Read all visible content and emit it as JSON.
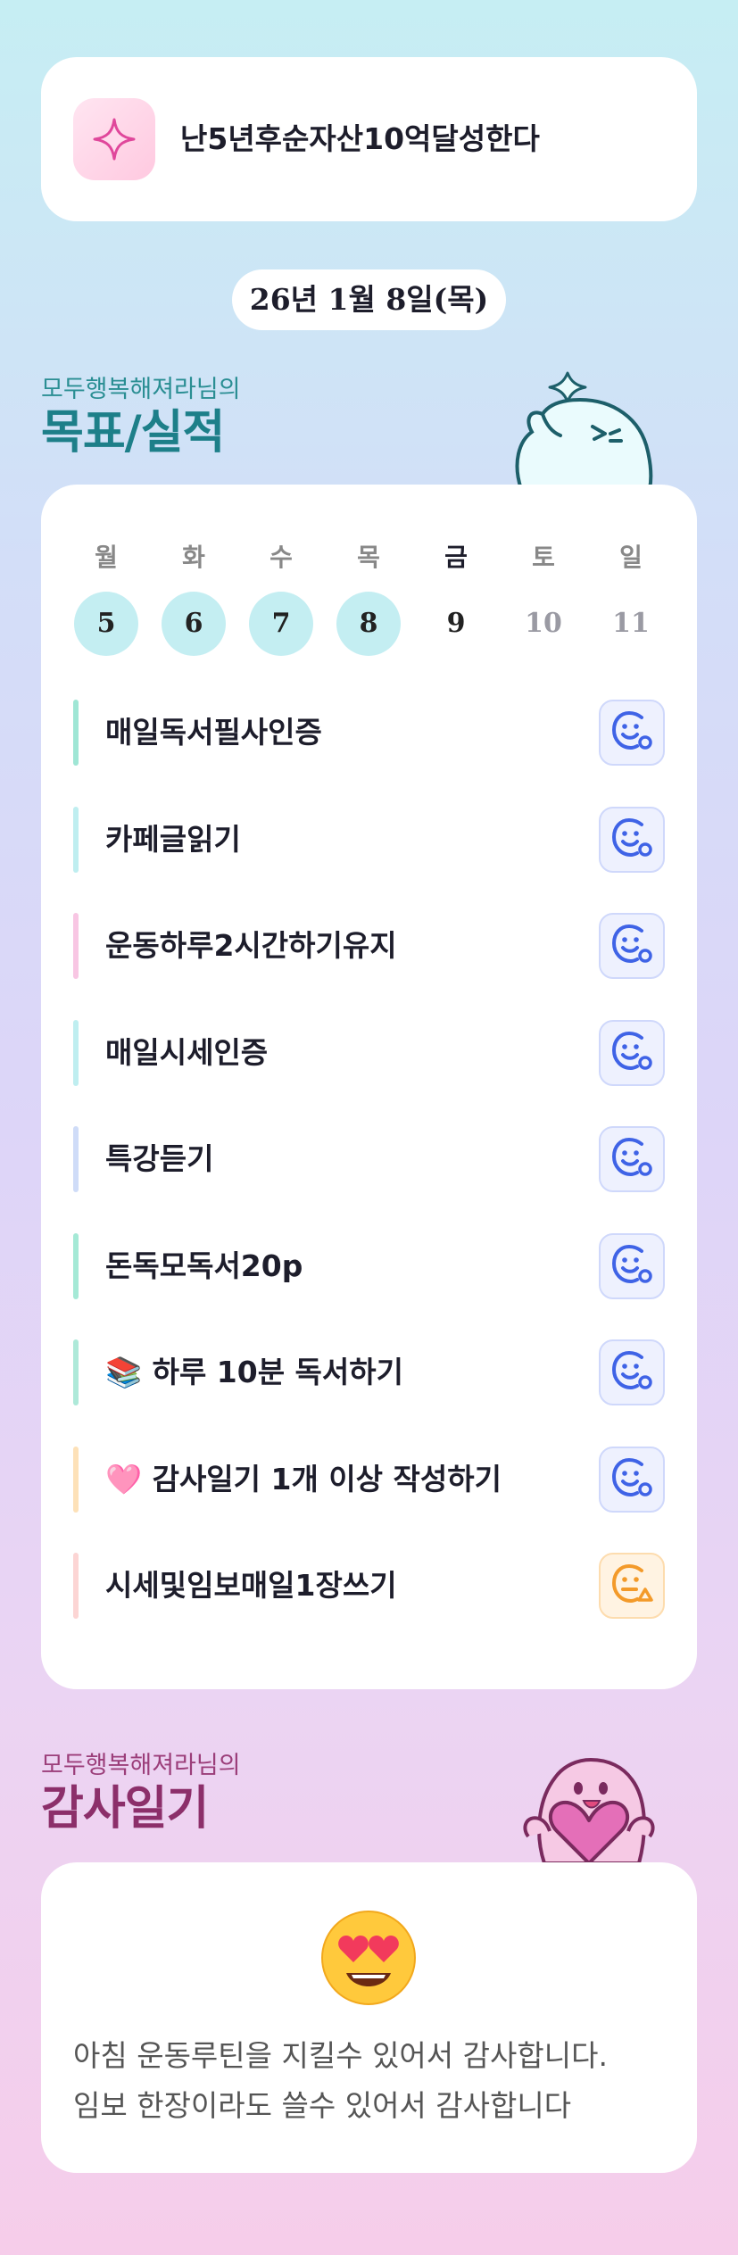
{
  "goal": {
    "text": "난5년후순자산10억달성한다",
    "icon": "sparkle-icon"
  },
  "date_label": "26년 1월 8일(목)",
  "goals_section": {
    "subtitle": "모두행복해져라님의",
    "title": "목표/실적"
  },
  "calendar": {
    "weekdays": [
      "월",
      "화",
      "수",
      "목",
      "금",
      "토",
      "일"
    ],
    "days": [
      "5",
      "6",
      "7",
      "8",
      "9",
      "10",
      "11"
    ],
    "completed_days": [
      "5",
      "6",
      "7",
      "8"
    ],
    "today": "9"
  },
  "tasks": [
    {
      "label": "매일독서필사인증",
      "bar_color": "#9fe6d5",
      "status": "smile-check"
    },
    {
      "label": "카페글읽기",
      "bar_color": "#bfeef0",
      "status": "smile-check"
    },
    {
      "label": "운동하루2시간하기유지",
      "bar_color": "#f8c6e3",
      "status": "smile-check"
    },
    {
      "label": "매일시세인증",
      "bar_color": "#bfeef0",
      "status": "smile-check"
    },
    {
      "label": "특강듣기",
      "bar_color": "#cfdcf8",
      "status": "smile-check"
    },
    {
      "label": "돈독모독서20p",
      "bar_color": "#a5e9d6",
      "status": "smile-check"
    },
    {
      "label": "📚 하루 10분 독서하기",
      "bar_color": "#aee9d9",
      "status": "smile-check"
    },
    {
      "label": "🩷 감사일기 1개 이상 작성하기",
      "bar_color": "#fde1b8",
      "status": "smile-check"
    },
    {
      "label": "시세및임보매일1장쓰기",
      "bar_color": "#fcd5d4",
      "status": "meh-warning"
    }
  ],
  "gratitude_section": {
    "subtitle": "모두행복해져라님의",
    "title": "감사일기"
  },
  "gratitude": {
    "emoji": "heart-eyes-emoji",
    "lines": [
      "아침 운동루틴을 지킬수 있어서 감사합니다.",
      "임보 한장이라도 쓸수 있어서 감사합니다"
    ]
  },
  "colors": {
    "ok_icon": "#3f63e6",
    "warn_icon": "#f39a2a",
    "done_day": "#c4eef2",
    "goals_title": "#1d7f89",
    "gratitude_title": "#8c2f6a"
  }
}
